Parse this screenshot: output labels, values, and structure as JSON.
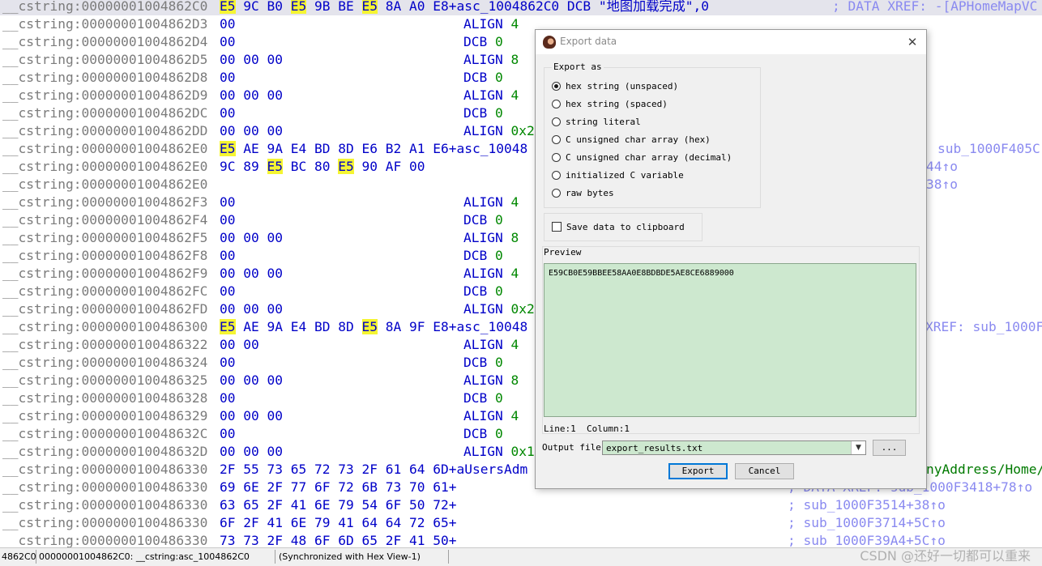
{
  "listing": {
    "rows": [
      {
        "seg": "__cstring:00000001004862C0",
        "bytes": [
          {
            "t": "E5",
            "hl": true
          },
          {
            "t": "9C"
          },
          {
            "t": "B0"
          },
          {
            "t": "E5",
            "hl": true
          },
          {
            "t": "9B"
          },
          {
            "t": "BE"
          },
          {
            "t": "E5",
            "hl": true
          },
          {
            "t": "8A"
          },
          {
            "t": "A0"
          }
        ],
        "tail": "E8+asc_1004862C0 DCB \"地图加载完成\",0",
        "dir": "",
        "num": "",
        "comment": "; DATA XREF: -[APHomeMapVC",
        "current": true
      },
      {
        "seg": "__cstring:00000001004862D3",
        "bytes": [
          {
            "t": "00"
          }
        ],
        "tail": "",
        "dir": "ALIGN",
        "num": "4",
        "comment": ""
      },
      {
        "seg": "__cstring:00000001004862D4",
        "bytes": [
          {
            "t": "00"
          }
        ],
        "tail": "",
        "dir": "DCB",
        "num": "0",
        "comment": ""
      },
      {
        "seg": "__cstring:00000001004862D5",
        "bytes": [
          {
            "t": "00"
          },
          {
            "t": "00"
          },
          {
            "t": "00"
          }
        ],
        "tail": "",
        "dir": "ALIGN",
        "num": "8",
        "comment": ""
      },
      {
        "seg": "__cstring:00000001004862D8",
        "bytes": [
          {
            "t": "00"
          }
        ],
        "tail": "",
        "dir": "DCB",
        "num": "0",
        "comment": ""
      },
      {
        "seg": "__cstring:00000001004862D9",
        "bytes": [
          {
            "t": "00"
          },
          {
            "t": "00"
          },
          {
            "t": "00"
          }
        ],
        "tail": "",
        "dir": "ALIGN",
        "num": "4",
        "comment": ""
      },
      {
        "seg": "__cstring:00000001004862DC",
        "bytes": [
          {
            "t": "00"
          }
        ],
        "tail": "",
        "dir": "DCB",
        "num": "0",
        "comment": ""
      },
      {
        "seg": "__cstring:00000001004862DD",
        "bytes": [
          {
            "t": "00"
          },
          {
            "t": "00"
          },
          {
            "t": "00"
          }
        ],
        "tail": "",
        "dir": "ALIGN",
        "num": "0x2",
        "comment": ""
      },
      {
        "seg": "__cstring:00000001004862E0",
        "bytes": [
          {
            "t": "E5",
            "hl": true
          },
          {
            "t": "AE"
          },
          {
            "t": "9A"
          },
          {
            "t": "E4"
          },
          {
            "t": "BD"
          },
          {
            "t": "8D"
          },
          {
            "t": "E6"
          },
          {
            "t": "B2"
          },
          {
            "t": "A1"
          }
        ],
        "tail": "E6+asc_10048",
        "dir": "",
        "num": "",
        "comment": "sub_1000F405C"
      },
      {
        "seg": "__cstring:00000001004862E0",
        "bytes": [
          {
            "t": "9C"
          },
          {
            "t": "89"
          },
          {
            "t": "E5",
            "hl": true
          },
          {
            "t": "BC"
          },
          {
            "t": "80"
          },
          {
            "t": "E5",
            "hl": true
          },
          {
            "t": "90"
          },
          {
            "t": "AF"
          },
          {
            "t": "00"
          }
        ],
        "tail": "",
        "dir": "",
        "num": "",
        "comment": "44↑o"
      },
      {
        "seg": "__cstring:00000001004862E0",
        "bytes": [],
        "tail": "",
        "dir": "",
        "num": "",
        "comment": "38↑o"
      },
      {
        "seg": "__cstring:00000001004862F3",
        "bytes": [
          {
            "t": "00"
          }
        ],
        "tail": "",
        "dir": "ALIGN",
        "num": "4",
        "comment": ""
      },
      {
        "seg": "__cstring:00000001004862F4",
        "bytes": [
          {
            "t": "00"
          }
        ],
        "tail": "",
        "dir": "DCB",
        "num": "0",
        "comment": ""
      },
      {
        "seg": "__cstring:00000001004862F5",
        "bytes": [
          {
            "t": "00"
          },
          {
            "t": "00"
          },
          {
            "t": "00"
          }
        ],
        "tail": "",
        "dir": "ALIGN",
        "num": "8",
        "comment": ""
      },
      {
        "seg": "__cstring:00000001004862F8",
        "bytes": [
          {
            "t": "00"
          }
        ],
        "tail": "",
        "dir": "DCB",
        "num": "0",
        "comment": ""
      },
      {
        "seg": "__cstring:00000001004862F9",
        "bytes": [
          {
            "t": "00"
          },
          {
            "t": "00"
          },
          {
            "t": "00"
          }
        ],
        "tail": "",
        "dir": "ALIGN",
        "num": "4",
        "comment": ""
      },
      {
        "seg": "__cstring:00000001004862FC",
        "bytes": [
          {
            "t": "00"
          }
        ],
        "tail": "",
        "dir": "DCB",
        "num": "0",
        "comment": ""
      },
      {
        "seg": "__cstring:00000001004862FD",
        "bytes": [
          {
            "t": "00"
          },
          {
            "t": "00"
          },
          {
            "t": "00"
          }
        ],
        "tail": "",
        "dir": "ALIGN",
        "num": "0x2",
        "comment": ""
      },
      {
        "seg": "__cstring:0000000100486300",
        "bytes": [
          {
            "t": "E5",
            "hl": true
          },
          {
            "t": "AE"
          },
          {
            "t": "9A"
          },
          {
            "t": "E4"
          },
          {
            "t": "BD"
          },
          {
            "t": "8D"
          },
          {
            "t": "E5",
            "hl": true
          },
          {
            "t": "8A"
          },
          {
            "t": "9F"
          }
        ],
        "tail": "E8+asc_10048",
        "dir": "",
        "num": "",
        "comment": "XREF: sub_1000F"
      },
      {
        "seg": "__cstring:0000000100486322",
        "bytes": [
          {
            "t": "00"
          },
          {
            "t": "00"
          }
        ],
        "tail": "",
        "dir": "ALIGN",
        "num": "4",
        "comment": ""
      },
      {
        "seg": "__cstring:0000000100486324",
        "bytes": [
          {
            "t": "00"
          }
        ],
        "tail": "",
        "dir": "DCB",
        "num": "0",
        "comment": ""
      },
      {
        "seg": "__cstring:0000000100486325",
        "bytes": [
          {
            "t": "00"
          },
          {
            "t": "00"
          },
          {
            "t": "00"
          }
        ],
        "tail": "",
        "dir": "ALIGN",
        "num": "8",
        "comment": ""
      },
      {
        "seg": "__cstring:0000000100486328",
        "bytes": [
          {
            "t": "00"
          }
        ],
        "tail": "",
        "dir": "DCB",
        "num": "0",
        "comment": ""
      },
      {
        "seg": "__cstring:0000000100486329",
        "bytes": [
          {
            "t": "00"
          },
          {
            "t": "00"
          },
          {
            "t": "00"
          }
        ],
        "tail": "",
        "dir": "ALIGN",
        "num": "4",
        "comment": ""
      },
      {
        "seg": "__cstring:000000010048632C",
        "bytes": [
          {
            "t": "00"
          }
        ],
        "tail": "",
        "dir": "DCB",
        "num": "0",
        "comment": ""
      },
      {
        "seg": "__cstring:000000010048632D",
        "bytes": [
          {
            "t": "00"
          },
          {
            "t": "00"
          },
          {
            "t": "00"
          }
        ],
        "tail": "",
        "dir": "ALIGN",
        "num": "0x1",
        "comment": ""
      },
      {
        "seg": "__cstring:0000000100486330",
        "bytes": [
          {
            "t": "2F"
          },
          {
            "t": "55"
          },
          {
            "t": "73"
          },
          {
            "t": "65"
          },
          {
            "t": "72"
          },
          {
            "t": "73"
          },
          {
            "t": "2F"
          },
          {
            "t": "61"
          },
          {
            "t": "64"
          }
        ],
        "tail": "6D+aUsersAdm",
        "dir": "",
        "num": "",
        "comment": "nyAddress/Home/",
        "green": true
      },
      {
        "seg": "__cstring:0000000100486330",
        "bytes": [
          {
            "t": "69"
          },
          {
            "t": "6E"
          },
          {
            "t": "2F"
          },
          {
            "t": "77"
          },
          {
            "t": "6F"
          },
          {
            "t": "72"
          },
          {
            "t": "6B"
          },
          {
            "t": "73"
          },
          {
            "t": "70"
          }
        ],
        "tail": "61+",
        "dir": "",
        "num": "",
        "comment": "; DATA XREF: sub_1000F3418+78↑o"
      },
      {
        "seg": "__cstring:0000000100486330",
        "bytes": [
          {
            "t": "63"
          },
          {
            "t": "65"
          },
          {
            "t": "2F"
          },
          {
            "t": "41"
          },
          {
            "t": "6E"
          },
          {
            "t": "79"
          },
          {
            "t": "54"
          },
          {
            "t": "6F"
          },
          {
            "t": "50"
          }
        ],
        "tail": "72+",
        "dir": "",
        "num": "",
        "comment": "; sub_1000F3514+38↑o"
      },
      {
        "seg": "__cstring:0000000100486330",
        "bytes": [
          {
            "t": "6F"
          },
          {
            "t": "2F"
          },
          {
            "t": "41"
          },
          {
            "t": "6E"
          },
          {
            "t": "79"
          },
          {
            "t": "41"
          },
          {
            "t": "64"
          },
          {
            "t": "64"
          },
          {
            "t": "72"
          }
        ],
        "tail": "65+",
        "dir": "",
        "num": "",
        "comment": "; sub_1000F3714+5C↑o"
      },
      {
        "seg": "__cstring:0000000100486330",
        "bytes": [
          {
            "t": "73"
          },
          {
            "t": "73"
          },
          {
            "t": "2F"
          },
          {
            "t": "48"
          },
          {
            "t": "6F"
          },
          {
            "t": "6D"
          },
          {
            "t": "65"
          },
          {
            "t": "2F"
          },
          {
            "t": "41"
          }
        ],
        "tail": "50+",
        "dir": "",
        "num": "",
        "comment": "; sub_1000F39A4+5C↑o"
      }
    ]
  },
  "status": {
    "left": "4862C0",
    "address": "00000001004862C0: __cstring:asc_1004862C0",
    "sync": "(Synchronized with Hex View-1)",
    "watermark": "CSDN @还好一切都可以重来"
  },
  "dialog": {
    "title": "Export data",
    "close_label": "✕",
    "export_as_label": "Export as",
    "options": [
      {
        "label": "hex string (unspaced)",
        "checked": true
      },
      {
        "label": "hex string (spaced)",
        "checked": false
      },
      {
        "label": "string literal",
        "checked": false
      },
      {
        "label": "C unsigned char array (hex)",
        "checked": false
      },
      {
        "label": "C unsigned char array (decimal)",
        "checked": false
      },
      {
        "label": "initialized C variable",
        "checked": false
      },
      {
        "label": "raw bytes",
        "checked": false
      }
    ],
    "clipboard_label": "Save data to clipboard",
    "clipboard_checked": false,
    "preview_label": "Preview",
    "preview_text": "E59CB0E59BBEE58AA0E8BDBDE5AE8CE6889000",
    "cursor_pos": "Line:1  Column:1",
    "output_file_label": "Output file",
    "output_file_value": "export_results.txt",
    "browse_label": "...",
    "export_button": "Export",
    "cancel_button": "Cancel"
  },
  "colors": {
    "listing_bytes": "#0000c8",
    "listing_segment": "#7b7b7b",
    "byte_highlight": "#f5f532",
    "preview_bg": "#cde8cf",
    "default_button_border": "#0078d7"
  }
}
